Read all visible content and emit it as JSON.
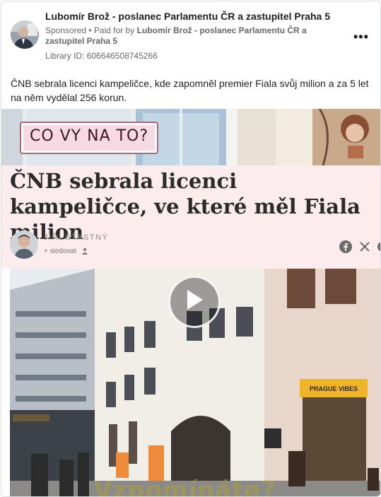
{
  "post": {
    "page_name": "Lubomír Brož - poslanec Parlamentu ČR a zastupitel Praha 5",
    "sponsored": "Sponsored",
    "separator": "•",
    "paid_for_by": "Paid for by",
    "payer": "Lubomír Brož - poslanec Parlamentu ČR a zastupitel Praha 5",
    "library_id": "Library ID: 606646508745266",
    "more_icon": "more-options-icon",
    "caption": "ČNB sebrala licenci kampeličce, kde zapomněl premier Fiala svůj milion a za 5 let na něm vydělal 256 korun."
  },
  "media": {
    "banner": "CO VY NA TO?",
    "headline": "ČNB sebrala licenci kampeličce, ve které měl Fiala milion",
    "author": "JIŘÍ ŠŤASTNÝ",
    "follow": "+ sledovat",
    "watermark": "Vzpomínáte?",
    "shop_sign": "PRAGUE VIBES",
    "colors": {
      "article_bg": "#fdecee",
      "banner_bg": "#f6d9e3",
      "banner_border": "#a46a77"
    }
  }
}
